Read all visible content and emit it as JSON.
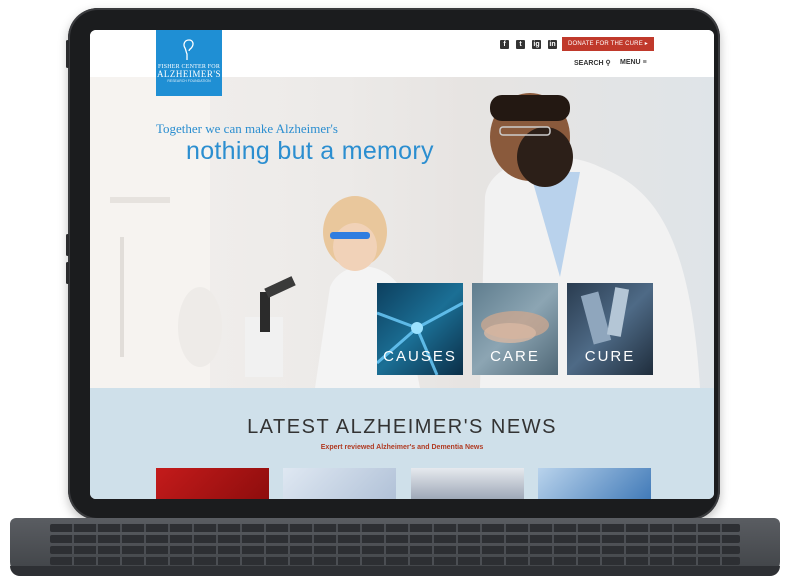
{
  "header": {
    "logo": {
      "line1": "FISHER CENTER FOR",
      "line2": "ALZHEIMER'S",
      "line3": "RESEARCH FOUNDATION"
    },
    "socials": [
      "f",
      "t",
      "ig",
      "in"
    ],
    "donate_label": "DONATE FOR THE CURE ▸",
    "search_label": "SEARCH",
    "menu_label": "MENU"
  },
  "hero": {
    "tagline_line1": "Together we can make Alzheimer's",
    "tagline_line2": "nothing but a memory",
    "tiles": [
      {
        "label": "CAUSES"
      },
      {
        "label": "CARE"
      },
      {
        "label": "CURE"
      }
    ]
  },
  "news": {
    "title": "LATEST ALZHEIMER'S NEWS",
    "subtitle": "Expert reviewed Alzheimer's and Dementia News"
  },
  "colors": {
    "brand_blue": "#1f8fd4",
    "donate_red": "#c0392b",
    "news_bg": "#cfe0ea"
  }
}
